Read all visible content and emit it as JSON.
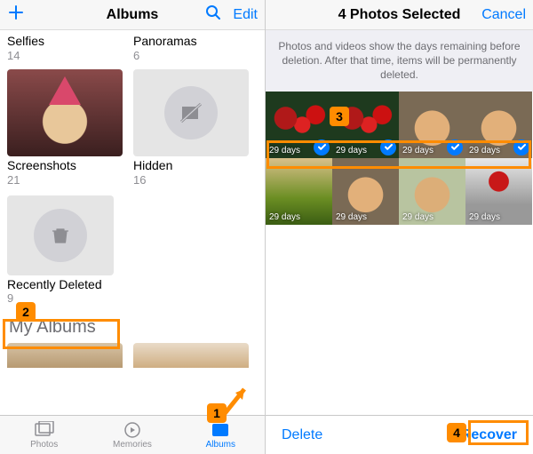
{
  "left": {
    "title": "Albums",
    "edit": "Edit",
    "albums_row1": [
      {
        "name": "Selfies",
        "count": "14"
      },
      {
        "name": "Panoramas",
        "count": "6"
      }
    ],
    "albums_row2": [
      {
        "name": "Screenshots",
        "count": "21"
      },
      {
        "name": "Hidden",
        "count": "16"
      }
    ],
    "recently_deleted": {
      "name": "Recently Deleted",
      "count": "9"
    },
    "my_albums_header": "My Albums",
    "tabs": {
      "photos": "Photos",
      "memories": "Memories",
      "albums": "Albums"
    }
  },
  "right": {
    "title": "4 Photos Selected",
    "cancel": "Cancel",
    "banner": "Photos and videos show the days remaining before deletion. After that time, items will be permanently deleted.",
    "cells": [
      {
        "days": "29 days",
        "selected": true
      },
      {
        "days": "29 days",
        "selected": true
      },
      {
        "days": "29 days",
        "selected": true
      },
      {
        "days": "29 days",
        "selected": true
      },
      {
        "days": "29 days",
        "selected": false
      },
      {
        "days": "29 days",
        "selected": false
      },
      {
        "days": "29 days",
        "selected": false
      },
      {
        "days": "29 days",
        "selected": false
      }
    ],
    "delete": "Delete",
    "recover": "Recover"
  },
  "annotations": {
    "n1": "1",
    "n2": "2",
    "n3": "3",
    "n4": "4"
  }
}
